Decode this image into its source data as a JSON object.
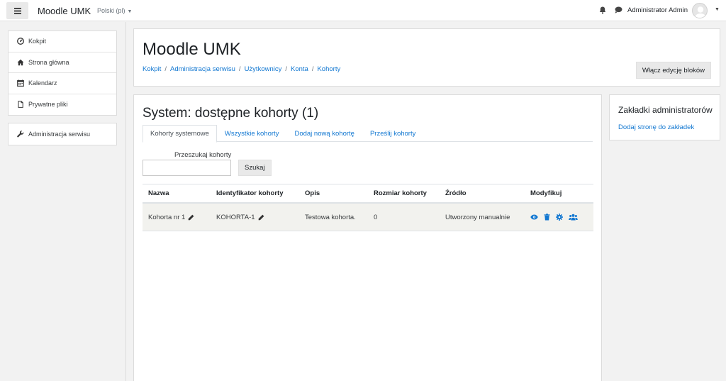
{
  "navbar": {
    "brand": "Moodle UMK",
    "language": "Polski (pl)",
    "username": "Administrator Admin"
  },
  "drawer": {
    "primary": [
      {
        "label": "Kokpit",
        "icon": "dashboard-icon"
      },
      {
        "label": "Strona główna",
        "icon": "home-icon"
      },
      {
        "label": "Kalendarz",
        "icon": "calendar-icon"
      },
      {
        "label": "Prywatne pliki",
        "icon": "file-icon"
      }
    ],
    "secondary": [
      {
        "label": "Administracja serwisu",
        "icon": "wrench-icon"
      }
    ]
  },
  "header": {
    "title": "Moodle UMK",
    "breadcrumb": [
      "Kokpit",
      "Administracja serwisu",
      "Użytkownicy",
      "Konta",
      "Kohorty"
    ],
    "edit_button": "Włącz edycję bloków"
  },
  "main": {
    "title": "System: dostępne kohorty (1)",
    "tabs": [
      "Kohorty systemowe",
      "Wszystkie kohorty",
      "Dodaj nową kohortę",
      "Prześlij kohorty"
    ],
    "active_tab": 0,
    "search_label": "Przeszukaj kohorty",
    "search_value": "",
    "search_button": "Szukaj",
    "table": {
      "headers": [
        "Nazwa",
        "Identyfikator kohorty",
        "Opis",
        "Rozmiar kohorty",
        "Źródło",
        "Modyfikuj"
      ],
      "rows": [
        {
          "name": "Kohorta nr 1",
          "idnumber": "KOHORTA-1",
          "description": "Testowa kohorta.",
          "size": "0",
          "source": "Utworzony manualnie",
          "actions": [
            "eye-icon",
            "trash-icon",
            "cog-icon",
            "users-icon"
          ]
        }
      ]
    }
  },
  "block": {
    "title": "Zakładki administratorów",
    "link": "Dodaj stronę do zakładek"
  },
  "colors": {
    "link": "#1177d1",
    "background": "#f2f2f2",
    "row_highlight": "#f2f2ee"
  }
}
